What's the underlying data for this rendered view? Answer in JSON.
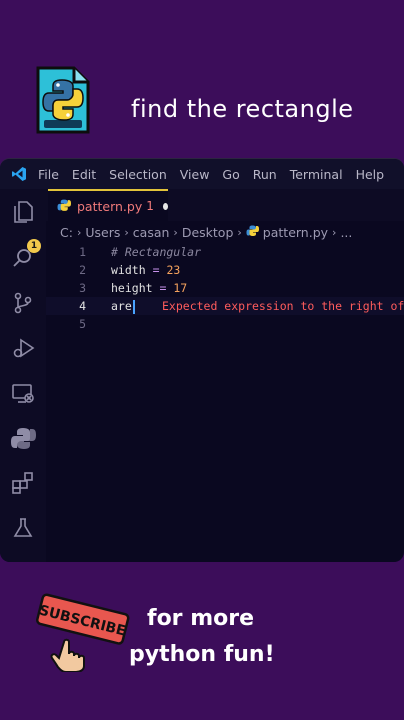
{
  "header": {
    "title": "find the rectangle",
    "logo_icon": "python-file-icon"
  },
  "menubar": {
    "items": [
      "File",
      "Edit",
      "Selection",
      "View",
      "Go",
      "Run",
      "Terminal",
      "Help"
    ]
  },
  "activitybar": {
    "explorer_badge": "1",
    "icons": [
      "files-icon",
      "search-icon",
      "source-control-icon",
      "run-debug-icon",
      "remote-explorer-icon",
      "python-icon",
      "extensions-icon",
      "testing-icon"
    ]
  },
  "tab": {
    "label": "pattern.py",
    "problem_count": "1"
  },
  "breadcrumb": {
    "items": [
      "C:",
      "Users",
      "casan",
      "Desktop",
      "pattern.py",
      "..."
    ]
  },
  "code": {
    "lines": [
      {
        "num": "1",
        "comment": "# Rectangular"
      },
      {
        "num": "2",
        "name": "width",
        "op": "=",
        "value": "23"
      },
      {
        "num": "3",
        "name": "height",
        "op": "=",
        "value": "17"
      },
      {
        "num": "4",
        "name": "are",
        "error": "Expected expression to the right of"
      },
      {
        "num": "5"
      }
    ]
  },
  "promo": {
    "subscribe_label": "SUBSCRIBE",
    "line1": "for more",
    "line2": "python fun!"
  },
  "colors": {
    "background": "#3c0d5a",
    "accent_tab": "#e2c33a",
    "error": "#ff5c5c"
  }
}
